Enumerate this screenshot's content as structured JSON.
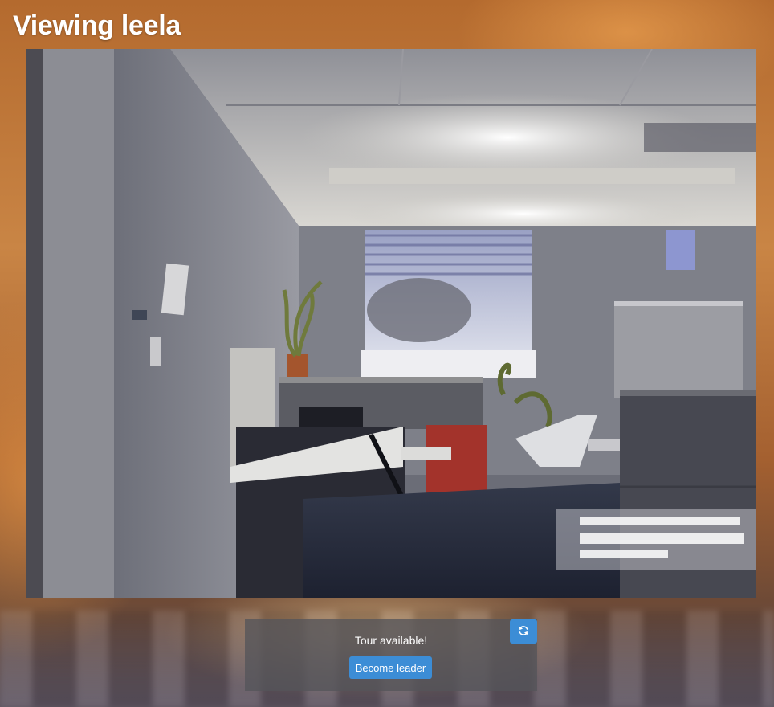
{
  "page": {
    "title": "Viewing leela"
  },
  "video": {
    "icon": "camera-feed",
    "overlay_icon": "watermark-text-block"
  },
  "tour": {
    "status_text": "Tour available!",
    "leader_button_label": "Become leader",
    "refresh_icon": "refresh-icon"
  },
  "colors": {
    "accent": "#3c8dd6",
    "title": "#ffffff",
    "panel": "#55555a"
  }
}
